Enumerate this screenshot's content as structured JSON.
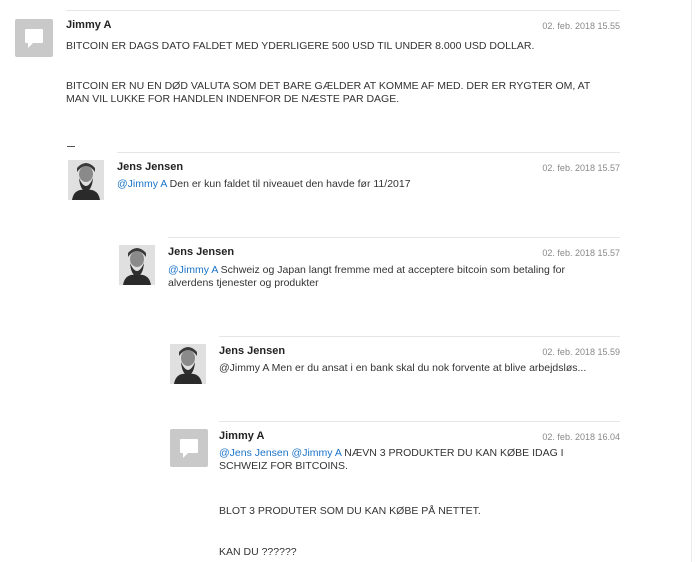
{
  "comments": [
    {
      "author": "Jimmy A",
      "date": "02. feb. 2018 15.55",
      "paragraphs": [
        "BITCOIN ER DAGS DATO FALDET MED YDERLIGERE 500 USD TIL UNDER 8.000 USD DOLLAR.",
        "BITCOIN ER NU EN DØD VALUTA SOM DET BARE GÆLDER AT KOMME AF MED. DER ER RYGTER OM, AT MAN VIL LUKKE FOR HANDLEN INDENFOR DE NÆSTE PAR DAGE."
      ]
    },
    {
      "author": "Jens Jensen",
      "date": "02. feb. 2018 15.57",
      "mention": "@Jimmy A",
      "text": " Den er kun faldet til niveauet den havde før 11/2017"
    },
    {
      "author": "Jens Jensen",
      "date": "02. feb. 2018 15.57",
      "mention": "@Jimmy A",
      "text": " Schweiz og Japan langt fremme med at acceptere bitcoin som betaling for alverdens tjenester og produkter"
    },
    {
      "author": "Jens Jensen",
      "date": "02. feb. 2018 15.59",
      "text": "@Jimmy A Men er du ansat i en bank skal du nok forvente at blive arbejdsløs..."
    },
    {
      "author": "Jimmy A",
      "date": "02. feb. 2018 16.04",
      "mention": "@Jens Jensen @Jimmy A",
      "text": " NÆVN 3 PRODUKTER DU KAN KØBE IDAG I SCHWEIZ FOR BITCOINS.",
      "paragraphs": [
        "BLOT 3 PRODUTER SOM DU KAN KØBE PÅ NETTET.",
        "KAN DU ??????"
      ]
    }
  ],
  "icons": {
    "generic_avatar": "speech-bubble-icon",
    "photo_avatar": "portrait-photo"
  }
}
